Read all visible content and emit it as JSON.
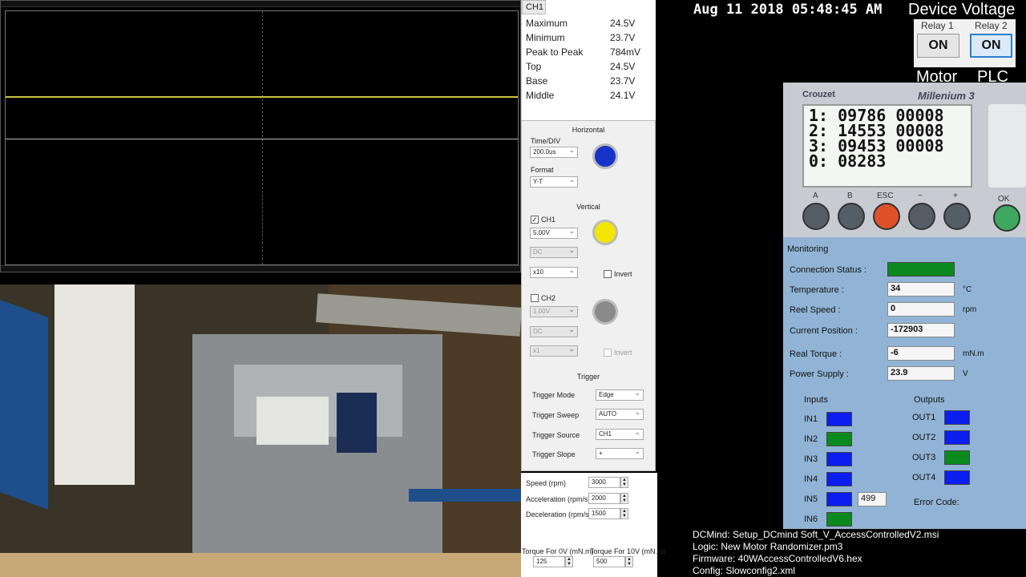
{
  "scope": {},
  "measurements": {
    "channel": "CH1",
    "rows": [
      {
        "label": "Maximum",
        "value": "24.5V"
      },
      {
        "label": "Minimum",
        "value": "23.7V"
      },
      {
        "label": "Peak to Peak",
        "value": "784mV"
      },
      {
        "label": "Top",
        "value": "24.5V"
      },
      {
        "label": "Base",
        "value": "23.7V"
      },
      {
        "label": "Middle",
        "value": "24.1V"
      }
    ]
  },
  "horizontal": {
    "title": "Horizontal",
    "timediv_label": "Time/DIV",
    "timediv_value": "200.0us",
    "format_label": "Format",
    "format_value": "Y-T"
  },
  "vertical": {
    "title": "Vertical",
    "ch1_label": "CH1",
    "ch1_volt": "5.00V",
    "ch1_coupling": "DC",
    "ch1_probe": "x10",
    "ch1_invert": "Invert",
    "ch2_label": "CH2",
    "ch2_volt": "1.00V",
    "ch2_coupling": "DC",
    "ch2_probe": "x1",
    "ch2_invert": "Invert",
    "ch1_color": "#f2e600",
    "ch2_color": "#8a8a8a",
    "horiz_color": "#1533c6"
  },
  "trigger": {
    "title": "Trigger",
    "mode_label": "Trigger Mode",
    "mode_value": "Edge",
    "sweep_label": "Trigger Sweep",
    "sweep_value": "AUTO",
    "source_label": "Trigger Source",
    "source_value": "CH1",
    "slope_label": "Trigger Slope",
    "slope_value": "+"
  },
  "motor": {
    "speed_label": "Speed (rpm)",
    "speed_value": "3000",
    "accel_label": "Acceleration (rpm/s)",
    "accel_value": "2000",
    "decel_label": "Deceleration (rpm/s)",
    "decel_value": "1500",
    "torque0_label": "Torque For 0V (mN.m)",
    "torque0_value": "125",
    "torque10_label": "Torque For 10V (mN.m)",
    "torque10_value": "500"
  },
  "header": {
    "datetime": "Aug 11 2018 05:48:45 AM",
    "device_voltage": "Device Voltage"
  },
  "relays": {
    "relay1_label": "Relay 1",
    "relay1_state": "ON",
    "relay2_label": "Relay 2",
    "relay2_state": "ON",
    "motor_label": "Motor",
    "plc_label": "PLC"
  },
  "plc": {
    "brand": "Crouzet",
    "model": "Millenium 3",
    "lcd_lines": [
      "1: 09786  00008",
      "2: 14553  00008",
      "3: 09453  00008",
      "0: 08283"
    ],
    "buttons": [
      "A",
      "B",
      "ESC",
      "−",
      "+",
      "OK"
    ]
  },
  "monitoring": {
    "title": "Monitoring",
    "connection_label": "Connection Status :",
    "connection_color": "#0a8a1e",
    "temperature_label": "Temperature :",
    "temperature_value": "34",
    "temperature_unit": "°C",
    "reel_label": "Reel Speed :",
    "reel_value": "0",
    "reel_unit": "rpm",
    "position_label": "Current Position :",
    "position_value": "-172903",
    "torque_label": "Real Torque :",
    "torque_value": "-6",
    "torque_unit": "mN.m",
    "power_label": "Power Supply :",
    "power_value": "23.9",
    "power_unit": "V",
    "inputs_title": "Inputs",
    "outputs_title": "Outputs",
    "inputs": [
      {
        "label": "IN1",
        "color": "#0a1ef0"
      },
      {
        "label": "IN2",
        "color": "#0a8a1e"
      },
      {
        "label": "IN3",
        "color": "#0a1ef0"
      },
      {
        "label": "IN4",
        "color": "#0a1ef0"
      },
      {
        "label": "IN5",
        "color": "#0a1ef0"
      },
      {
        "label": "IN6",
        "color": "#0a8a1e"
      }
    ],
    "in5_value": "499",
    "outputs": [
      {
        "label": "OUT1",
        "color": "#0a1ef0"
      },
      {
        "label": "OUT2",
        "color": "#0a1ef0"
      },
      {
        "label": "OUT3",
        "color": "#0a8a1e"
      },
      {
        "label": "OUT4",
        "color": "#0a1ef0"
      }
    ],
    "error_label": "Error Code:"
  },
  "info": {
    "line1": "DCMind: Setup_DCmind Soft_V_AccessControlledV2.msi",
    "line2": "Logic: New Motor Randomizer.pm3",
    "line3": "Firmware: 40WAccessControlledV6.hex",
    "line4": "Config: Slowconfig2.xml"
  }
}
